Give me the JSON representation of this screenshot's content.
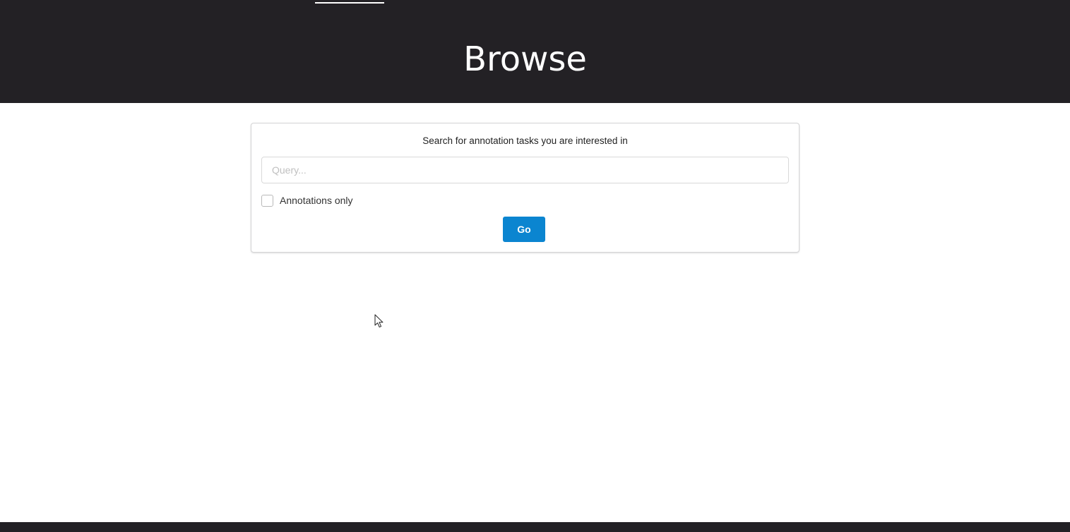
{
  "hero": {
    "title": "Browse"
  },
  "search": {
    "heading": "Search for annotation tasks you are interested in",
    "query_placeholder": "Query...",
    "query_value": "",
    "annotations_only_label": "Annotations only",
    "annotations_only_checked": false,
    "go_label": "Go"
  },
  "colors": {
    "header_background": "#232125",
    "go_button": "#0b85d0"
  }
}
